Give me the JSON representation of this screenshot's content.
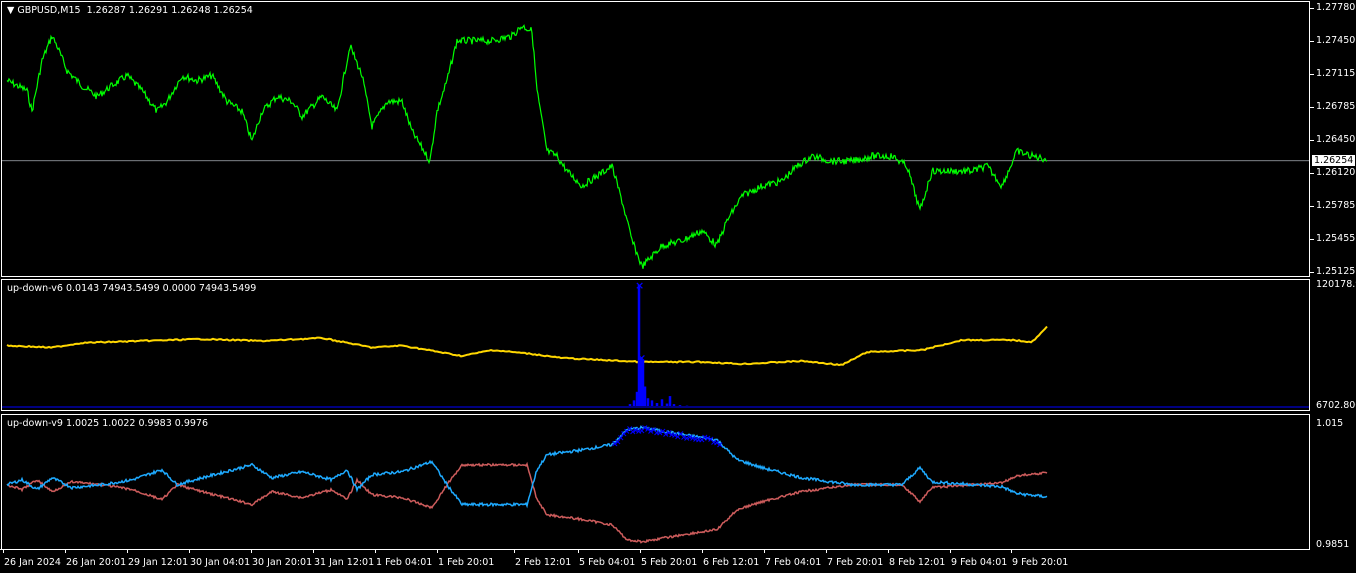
{
  "main": {
    "symbol_label": "GBPUSD,M15",
    "ohlc": "1.26287 1.26291 1.26248 1.26254",
    "current_price": "1.26254",
    "price_axis": [
      "1.27780",
      "1.27450",
      "1.27115",
      "1.26785",
      "1.26450",
      "1.26120",
      "1.25785",
      "1.25455",
      "1.25125"
    ],
    "line_color": "#00ff00",
    "price_keypoints": {
      "bar": [
        5,
        25,
        30,
        40,
        50,
        55,
        65,
        80,
        95,
        110,
        125,
        140,
        155,
        165,
        180,
        195,
        210,
        225,
        240,
        250,
        260,
        275,
        290,
        300,
        320,
        335,
        348,
        360,
        370,
        385,
        400,
        410,
        428,
        435,
        445,
        455,
        470,
        490,
        510,
        520,
        530,
        535,
        545,
        555,
        565,
        580,
        595,
        610,
        620,
        630,
        640,
        660,
        680,
        700,
        715,
        725,
        740,
        760,
        780,
        795,
        810,
        830,
        850,
        870,
        890,
        905,
        918,
        930,
        950,
        970,
        985,
        1000,
        1015,
        1030,
        1045
      ],
      "price": [
        1.2706,
        1.2696,
        1.2675,
        1.2726,
        1.2751,
        1.2741,
        1.2716,
        1.2701,
        1.269,
        1.2701,
        1.2711,
        1.2696,
        1.2675,
        1.2685,
        1.2711,
        1.2706,
        1.2711,
        1.2685,
        1.2675,
        1.2645,
        1.2675,
        1.269,
        1.2685,
        1.267,
        1.269,
        1.2675,
        1.2741,
        1.2711,
        1.266,
        1.2685,
        1.2685,
        1.2655,
        1.2625,
        1.2675,
        1.2706,
        1.2746,
        1.2746,
        1.2746,
        1.2751,
        1.2761,
        1.2756,
        1.2696,
        1.2635,
        1.263,
        1.2615,
        1.26,
        1.261,
        1.262,
        1.2585,
        1.2545,
        1.2519,
        1.254,
        1.2545,
        1.2555,
        1.254,
        1.2565,
        1.259,
        1.26,
        1.2605,
        1.262,
        1.263,
        1.2625,
        1.2625,
        1.263,
        1.263,
        1.262,
        1.2575,
        1.2615,
        1.2615,
        1.2615,
        1.262,
        1.26,
        1.2635,
        1.263,
        1.2627
      ]
    }
  },
  "ind1": {
    "label": "up-down-v6 0.0143 74943.5499 0.0000 74943.5499",
    "axis_top": "120178.93",
    "axis_bottom": "6702.806",
    "range": [
      6702.806,
      120178.93
    ],
    "yellow_color": "#ffd700",
    "blue_color": "#0000ff",
    "yellow": {
      "bar": [
        5,
        50,
        80,
        200,
        260,
        320,
        370,
        400,
        460,
        490,
        530,
        560,
        640,
        700,
        740,
        800,
        840,
        865,
        920,
        960,
        1010,
        1030,
        1045
      ],
      "value": [
        63400,
        61500,
        65900,
        69500,
        67700,
        70500,
        61500,
        63400,
        53600,
        59200,
        55500,
        51700,
        48000,
        48000,
        46100,
        48900,
        45100,
        57300,
        59200,
        68600,
        68600,
        66700,
        80800
      ]
    },
    "blue_bars": {
      "bar": [
        628,
        632,
        635,
        637,
        639,
        641,
        643,
        646,
        650,
        655,
        660,
        665,
        668,
        672,
        678,
        685
      ],
      "value": [
        8500,
        12000,
        20000,
        120178,
        52000,
        50000,
        25000,
        14000,
        12000,
        9500,
        13000,
        9000,
        16000,
        8500,
        7500,
        7000
      ]
    }
  },
  "ind2": {
    "label": "up-down-v9 1.0025 1.0022 0.9983 0.9976",
    "axis_top": "1.015",
    "axis_bottom": "0.9851",
    "range": [
      0.9851,
      1.015
    ],
    "blue_color": "#1eaaff",
    "red_color": "#cd5c5c",
    "bar": [
      5,
      20,
      35,
      50,
      70,
      100,
      130,
      160,
      175,
      200,
      250,
      270,
      300,
      330,
      345,
      355,
      370,
      400,
      430,
      445,
      460,
      500,
      525,
      535,
      545,
      580,
      610,
      625,
      640,
      680,
      715,
      735,
      760,
      800,
      850,
      900,
      918,
      930,
      960,
      1000,
      1015,
      1045
    ],
    "blue": [
      1.0,
      1.0012,
      0.9988,
      1.0017,
      0.9993,
      1.0,
      1.0012,
      1.0037,
      1.0,
      1.0017,
      1.0049,
      1.0017,
      1.0032,
      1.0012,
      1.0037,
      0.9988,
      1.0025,
      1.0032,
      1.0057,
      1.0,
      0.9951,
      0.9951,
      0.9951,
      1.0037,
      1.0074,
      1.0086,
      1.0099,
      1.0136,
      1.0141,
      1.0124,
      1.0111,
      1.0062,
      1.0042,
      1.0017,
      1.0,
      1.0,
      1.0042,
      1.0007,
      1.0002,
      0.9995,
      0.9978,
      0.997
    ]
  },
  "time_axis": [
    "26 Jan 2024",
    "26 Jan 20:01",
    "29 Jan 12:01",
    "30 Jan 04:01",
    "30 Jan 20:01",
    "31 Jan 12:01",
    "1 Feb 04:01",
    "1 Feb 20:01",
    "2 Feb 12:01",
    "5 Feb 04:01",
    "5 Feb 20:01",
    "6 Feb 12:01",
    "7 Feb 04:01",
    "7 Feb 20:01",
    "8 Feb 12:01",
    "9 Feb 04:01",
    "9 Feb 20:01"
  ]
}
